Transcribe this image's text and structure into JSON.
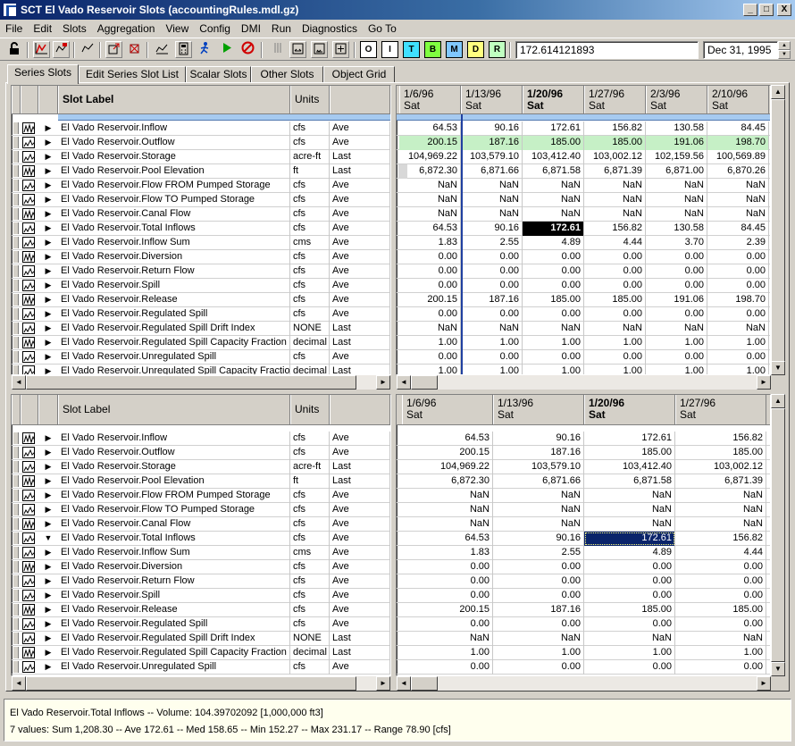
{
  "window": {
    "title": "SCT El Vado Reservoir Slots (accountingRules.mdl.gz)",
    "buttons": {
      "minimize": "_",
      "maximize": "□",
      "close": "X"
    }
  },
  "menu": [
    "File",
    "Edit",
    "Slots",
    "Aggregation",
    "View",
    "Config",
    "DMI",
    "Run",
    "Diagnostics",
    "Go To"
  ],
  "toolbar": {
    "letter_buttons": [
      "O",
      "I",
      "T",
      "B",
      "M",
      "D",
      "R"
    ],
    "letter_colors": [
      "#ffffff",
      "#ffffff",
      "#40e0ff",
      "#80ff40",
      "#80c8ff",
      "#ffff80",
      "#c0ffc0"
    ],
    "value_field": "172.614121893",
    "date_field": "Dec 31, 1995"
  },
  "tabs": [
    "Series Slots",
    "Edit Series Slot List",
    "Scalar Slots",
    "Other Slots",
    "Object Grid"
  ],
  "active_tab": "Series Slots",
  "top": {
    "headers": {
      "slot_label": "Slot Label",
      "units": "Units"
    },
    "dates": [
      {
        "date": "1/6/96",
        "day": "Sat"
      },
      {
        "date": "1/13/96",
        "day": "Sat"
      },
      {
        "date": "1/20/96",
        "day": "Sat"
      },
      {
        "date": "1/27/96",
        "day": "Sat"
      },
      {
        "date": "2/3/96",
        "day": "Sat"
      },
      {
        "date": "2/10/96",
        "day": "Sat"
      }
    ],
    "rows": [
      {
        "label": "El Vado Reservoir.Inflow",
        "units": "cfs",
        "agg": "Ave",
        "values": [
          "64.53",
          "90.16",
          "172.61",
          "156.82",
          "130.58",
          "84.45"
        ]
      },
      {
        "label": "El Vado Reservoir.Outflow",
        "units": "cfs",
        "agg": "Ave",
        "values": [
          "200.15",
          "187.16",
          "185.00",
          "185.00",
          "191.06",
          "198.70"
        ]
      },
      {
        "label": "El Vado Reservoir.Storage",
        "units": "acre-ft",
        "agg": "Last",
        "values": [
          "104,969.22",
          "103,579.10",
          "103,412.40",
          "103,002.12",
          "102,159.56",
          "100,569.89"
        ]
      },
      {
        "label": "El Vado Reservoir.Pool Elevation",
        "units": "ft",
        "agg": "Last",
        "values": [
          "6,872.30",
          "6,871.66",
          "6,871.58",
          "6,871.39",
          "6,871.00",
          "6,870.26"
        ]
      },
      {
        "label": "El Vado Reservoir.Flow FROM Pumped Storage",
        "units": "cfs",
        "agg": "Ave",
        "values": [
          "NaN",
          "NaN",
          "NaN",
          "NaN",
          "NaN",
          "NaN"
        ]
      },
      {
        "label": "El Vado Reservoir.Flow TO Pumped Storage",
        "units": "cfs",
        "agg": "Ave",
        "values": [
          "NaN",
          "NaN",
          "NaN",
          "NaN",
          "NaN",
          "NaN"
        ]
      },
      {
        "label": "El Vado Reservoir.Canal Flow",
        "units": "cfs",
        "agg": "Ave",
        "values": [
          "NaN",
          "NaN",
          "NaN",
          "NaN",
          "NaN",
          "NaN"
        ]
      },
      {
        "label": "El Vado Reservoir.Total Inflows",
        "units": "cfs",
        "agg": "Ave",
        "values": [
          "64.53",
          "90.16",
          "172.61",
          "156.82",
          "130.58",
          "84.45"
        ]
      },
      {
        "label": "El Vado Reservoir.Inflow Sum",
        "units": "cms",
        "agg": "Ave",
        "values": [
          "1.83",
          "2.55",
          "4.89",
          "4.44",
          "3.70",
          "2.39"
        ]
      },
      {
        "label": "El Vado Reservoir.Diversion",
        "units": "cfs",
        "agg": "Ave",
        "values": [
          "0.00",
          "0.00",
          "0.00",
          "0.00",
          "0.00",
          "0.00"
        ]
      },
      {
        "label": "El Vado Reservoir.Return Flow",
        "units": "cfs",
        "agg": "Ave",
        "values": [
          "0.00",
          "0.00",
          "0.00",
          "0.00",
          "0.00",
          "0.00"
        ]
      },
      {
        "label": "El Vado Reservoir.Spill",
        "units": "cfs",
        "agg": "Ave",
        "values": [
          "0.00",
          "0.00",
          "0.00",
          "0.00",
          "0.00",
          "0.00"
        ]
      },
      {
        "label": "El Vado Reservoir.Release",
        "units": "cfs",
        "agg": "Ave",
        "values": [
          "200.15",
          "187.16",
          "185.00",
          "185.00",
          "191.06",
          "198.70"
        ]
      },
      {
        "label": "El Vado Reservoir.Regulated Spill",
        "units": "cfs",
        "agg": "Ave",
        "values": [
          "0.00",
          "0.00",
          "0.00",
          "0.00",
          "0.00",
          "0.00"
        ]
      },
      {
        "label": "El Vado Reservoir.Regulated Spill Drift Index",
        "units": "NONE",
        "agg": "Last",
        "values": [
          "NaN",
          "NaN",
          "NaN",
          "NaN",
          "NaN",
          "NaN"
        ]
      },
      {
        "label": "El Vado Reservoir.Regulated Spill Capacity Fraction",
        "units": "decimal",
        "agg": "Last",
        "values": [
          "1.00",
          "1.00",
          "1.00",
          "1.00",
          "1.00",
          "1.00"
        ]
      },
      {
        "label": "El Vado Reservoir.Unregulated Spill",
        "units": "cfs",
        "agg": "Ave",
        "values": [
          "0.00",
          "0.00",
          "0.00",
          "0.00",
          "0.00",
          "0.00"
        ]
      },
      {
        "label": "El Vado Reservoir.Unregulated Spill Capacity Fraction",
        "units": "decimal",
        "agg": "Last",
        "values": [
          "1.00",
          "1.00",
          "1.00",
          "1.00",
          "1.00",
          "1.00"
        ]
      }
    ]
  },
  "bottom": {
    "headers": {
      "slot_label": "Slot Label",
      "units": "Units"
    },
    "dates": [
      {
        "date": "1/6/96",
        "day": "Sat"
      },
      {
        "date": "1/13/96",
        "day": "Sat"
      },
      {
        "date": "1/20/96",
        "day": "Sat"
      },
      {
        "date": "1/27/96",
        "day": "Sat"
      }
    ],
    "rows": [
      {
        "label": "El Vado Reservoir.Inflow",
        "units": "cfs",
        "agg": "Ave",
        "values": [
          "64.53",
          "90.16",
          "172.61",
          "156.82"
        ]
      },
      {
        "label": "El Vado Reservoir.Outflow",
        "units": "cfs",
        "agg": "Ave",
        "values": [
          "200.15",
          "187.16",
          "185.00",
          "185.00"
        ]
      },
      {
        "label": "El Vado Reservoir.Storage",
        "units": "acre-ft",
        "agg": "Last",
        "values": [
          "104,969.22",
          "103,579.10",
          "103,412.40",
          "103,002.12"
        ]
      },
      {
        "label": "El Vado Reservoir.Pool Elevation",
        "units": "ft",
        "agg": "Last",
        "values": [
          "6,872.30",
          "6,871.66",
          "6,871.58",
          "6,871.39"
        ]
      },
      {
        "label": "El Vado Reservoir.Flow FROM Pumped Storage",
        "units": "cfs",
        "agg": "Ave",
        "values": [
          "NaN",
          "NaN",
          "NaN",
          "NaN"
        ]
      },
      {
        "label": "El Vado Reservoir.Flow TO Pumped Storage",
        "units": "cfs",
        "agg": "Ave",
        "values": [
          "NaN",
          "NaN",
          "NaN",
          "NaN"
        ]
      },
      {
        "label": "El Vado Reservoir.Canal Flow",
        "units": "cfs",
        "agg": "Ave",
        "values": [
          "NaN",
          "NaN",
          "NaN",
          "NaN"
        ]
      },
      {
        "label": "El Vado Reservoir.Total Inflows",
        "units": "cfs",
        "agg": "Ave",
        "values": [
          "64.53",
          "90.16",
          "172.61",
          "156.82"
        ]
      },
      {
        "label": "El Vado Reservoir.Inflow Sum",
        "units": "cms",
        "agg": "Ave",
        "values": [
          "1.83",
          "2.55",
          "4.89",
          "4.44"
        ]
      },
      {
        "label": "El Vado Reservoir.Diversion",
        "units": "cfs",
        "agg": "Ave",
        "values": [
          "0.00",
          "0.00",
          "0.00",
          "0.00"
        ]
      },
      {
        "label": "El Vado Reservoir.Return Flow",
        "units": "cfs",
        "agg": "Ave",
        "values": [
          "0.00",
          "0.00",
          "0.00",
          "0.00"
        ]
      },
      {
        "label": "El Vado Reservoir.Spill",
        "units": "cfs",
        "agg": "Ave",
        "values": [
          "0.00",
          "0.00",
          "0.00",
          "0.00"
        ]
      },
      {
        "label": "El Vado Reservoir.Release",
        "units": "cfs",
        "agg": "Ave",
        "values": [
          "200.15",
          "187.16",
          "185.00",
          "185.00"
        ]
      },
      {
        "label": "El Vado Reservoir.Regulated Spill",
        "units": "cfs",
        "agg": "Ave",
        "values": [
          "0.00",
          "0.00",
          "0.00",
          "0.00"
        ]
      },
      {
        "label": "El Vado Reservoir.Regulated Spill Drift Index",
        "units": "NONE",
        "agg": "Last",
        "values": [
          "NaN",
          "NaN",
          "NaN",
          "NaN"
        ]
      },
      {
        "label": "El Vado Reservoir.Regulated Spill Capacity Fraction",
        "units": "decimal",
        "agg": "Last",
        "values": [
          "1.00",
          "1.00",
          "1.00",
          "1.00"
        ]
      },
      {
        "label": "El Vado Reservoir.Unregulated Spill",
        "units": "cfs",
        "agg": "Ave",
        "values": [
          "0.00",
          "0.00",
          "0.00",
          "0.00"
        ]
      }
    ]
  },
  "status": {
    "line1": "El Vado Reservoir.Total Inflows -- Volume: 104.39702092 [1,000,000 ft3]",
    "line2": "7 values:  Sum 1,208.30 -- Ave 172.61 -- Med 158.65 -- Min 152.27 -- Max 231.17 -- Range 78.90 [cfs]"
  },
  "colors": {
    "highlight_green": "#c6f0c6",
    "selection_navy": "#0a246a",
    "selection_black": "#000000"
  }
}
